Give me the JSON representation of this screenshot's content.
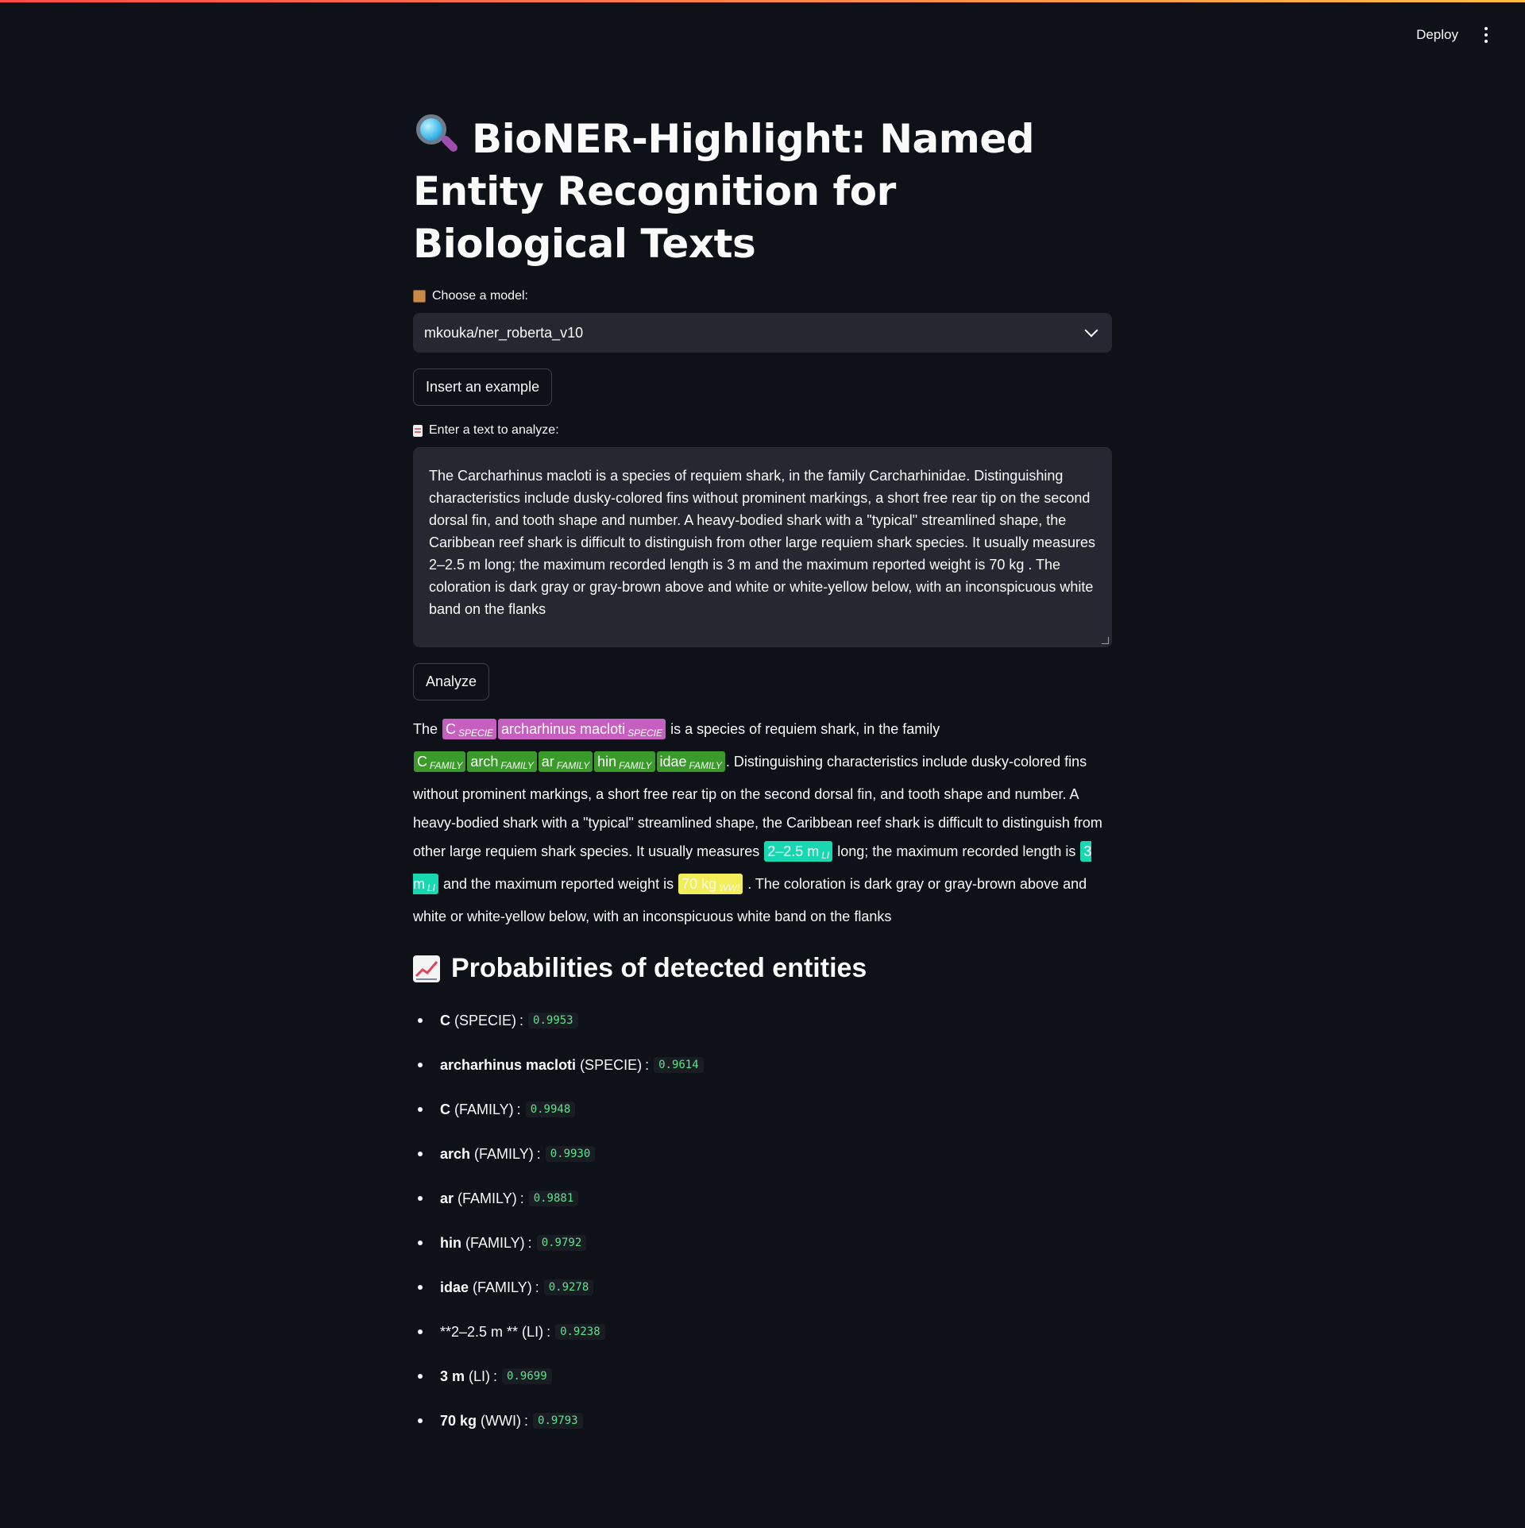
{
  "header": {
    "deploy_label": "Deploy"
  },
  "page": {
    "title": "BioNER-Highlight: Named Entity Recognition for Biological Texts",
    "title_icon": "magnifying-glass-icon"
  },
  "model": {
    "label": "Choose a model:",
    "label_icon": "package-icon",
    "selected": "mkouka/ner_roberta_v10"
  },
  "buttons": {
    "insert_example": "Insert an example",
    "analyze": "Analyze"
  },
  "input": {
    "label": "Enter a text to analyze:",
    "label_icon": "memo-icon",
    "value": "The Carcharhinus macloti is a species of requiem shark, in the family Carcharhinidae. Distinguishing characteristics include dusky-colored fins without prominent markings, a short free rear tip on the second dorsal fin, and tooth shape and number. A heavy-bodied shark with a \"typical\" streamlined shape, the Caribbean reef shark is difficult to distinguish from other large requiem shark species. It usually measures 2–2.5 m  long; the maximum recorded length is 3 m and the maximum reported weight is 70 kg . The coloration is dark gray or gray-brown above and white or white-yellow below, with an inconspicuous white band on the flanks"
  },
  "result": {
    "segments": [
      {
        "text": "The "
      },
      {
        "text": "C",
        "label": "SPECIE"
      },
      {
        "text": "archarhinus macloti",
        "label": "SPECIE"
      },
      {
        "text": " is a species of requiem shark, in the family "
      },
      {
        "text": "C",
        "label": "FAMILY"
      },
      {
        "text": "arch",
        "label": "FAMILY"
      },
      {
        "text": "ar",
        "label": "FAMILY"
      },
      {
        "text": "hin",
        "label": "FAMILY"
      },
      {
        "text": "idae",
        "label": "FAMILY"
      },
      {
        "text": ". Distinguishing characteristics include dusky-colored fins without prominent markings, a short free rear tip on the second dorsal fin, and tooth shape and number. A heavy-bodied shark with a \"typical\" streamlined shape, the Caribbean reef shark is difficult to distinguish from other large requiem shark species. It usually measures "
      },
      {
        "text": "2–2.5 m",
        "label": "LI"
      },
      {
        "text": " long; the maximum recorded length is "
      },
      {
        "text": "3 m",
        "label": "LI"
      },
      {
        "text": " and the maximum reported weight is "
      },
      {
        "text": "70 kg",
        "label": "WWI"
      },
      {
        "text": " . The coloration is dark gray or gray-brown above and white or white-yellow below, with an inconspicuous white band on the flanks"
      }
    ],
    "colors": {
      "SPECIE": "#c65fbf",
      "FAMILY": "#3a9a2a",
      "LI": "#17d8b0",
      "WWI": "#f1ee5a"
    }
  },
  "probabilities": {
    "title": "Probabilities of detected entities",
    "title_icon": "chart-increasing-icon",
    "items": [
      {
        "entity": "C",
        "type": "(SPECIE)",
        "score": "0.9953"
      },
      {
        "entity": "archarhinus macloti",
        "type": "(SPECIE)",
        "score": "0.9614"
      },
      {
        "entity": "C",
        "type": "(FAMILY)",
        "score": "0.9948"
      },
      {
        "entity": "arch",
        "type": "(FAMILY)",
        "score": "0.9930"
      },
      {
        "entity": "ar",
        "type": "(FAMILY)",
        "score": "0.9881"
      },
      {
        "entity": "hin",
        "type": "(FAMILY)",
        "score": "0.9792"
      },
      {
        "entity": "idae",
        "type": "(FAMILY)",
        "score": "0.9278"
      },
      {
        "entity": "",
        "type": "**2–2.5 m ** (LI)",
        "score": "0.9238"
      },
      {
        "entity": "3 m",
        "type": "(LI)",
        "score": "0.9699"
      },
      {
        "entity": "70 kg",
        "type": "(WWI)",
        "score": "0.9793"
      }
    ]
  }
}
